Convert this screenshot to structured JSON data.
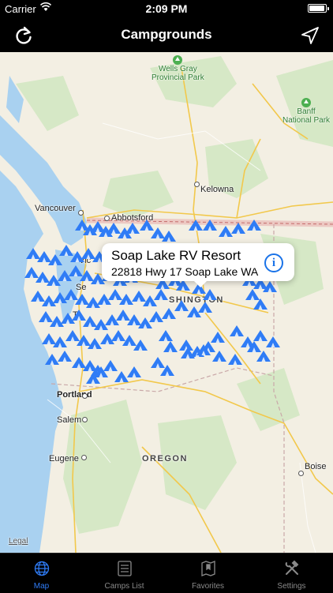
{
  "status_bar": {
    "carrier": "Carrier",
    "time": "2:09 PM",
    "battery_level": 0.95
  },
  "nav": {
    "title": "Campgrounds",
    "left_icon": "refresh-icon",
    "right_icon": "location-arrow-icon"
  },
  "map": {
    "place_labels": [
      {
        "key": "wells",
        "text": "Wells Gray\nProvincial Park"
      },
      {
        "key": "banff",
        "text": "Banff\nNational Park"
      },
      {
        "key": "kelowna",
        "text": "Kelowna"
      },
      {
        "key": "vancouver",
        "text": "Vancouver"
      },
      {
        "key": "abbotsford",
        "text": "Abbotsford"
      },
      {
        "key": "vic",
        "text": "Vic"
      },
      {
        "key": "se",
        "text": "Se"
      },
      {
        "key": "tac",
        "text": "Ta"
      },
      {
        "key": "shington",
        "text": "SHINGTON"
      },
      {
        "key": "portland",
        "text": "Portland"
      },
      {
        "key": "salem",
        "text": "Salem"
      },
      {
        "key": "eugene",
        "text": "Eugene"
      },
      {
        "key": "oregon",
        "text": "OREGON"
      },
      {
        "key": "boise",
        "text": "Boise"
      }
    ],
    "legal": "Legal",
    "callout": {
      "name": "Soap Lake RV Resort",
      "address": "22818 Hwy 17 Soap Lake WA",
      "icon": "info-icon"
    },
    "accent": "#2f7cf6",
    "pin_color": "#2f7cf6"
  },
  "tabs": [
    {
      "label": "Map",
      "icon": "globe-icon",
      "active": true
    },
    {
      "label": "Camps List",
      "icon": "list-icon",
      "active": false
    },
    {
      "label": "Favorites",
      "icon": "map-bookmark-icon",
      "active": false
    },
    {
      "label": "Settings",
      "icon": "tools-icon",
      "active": false
    }
  ]
}
